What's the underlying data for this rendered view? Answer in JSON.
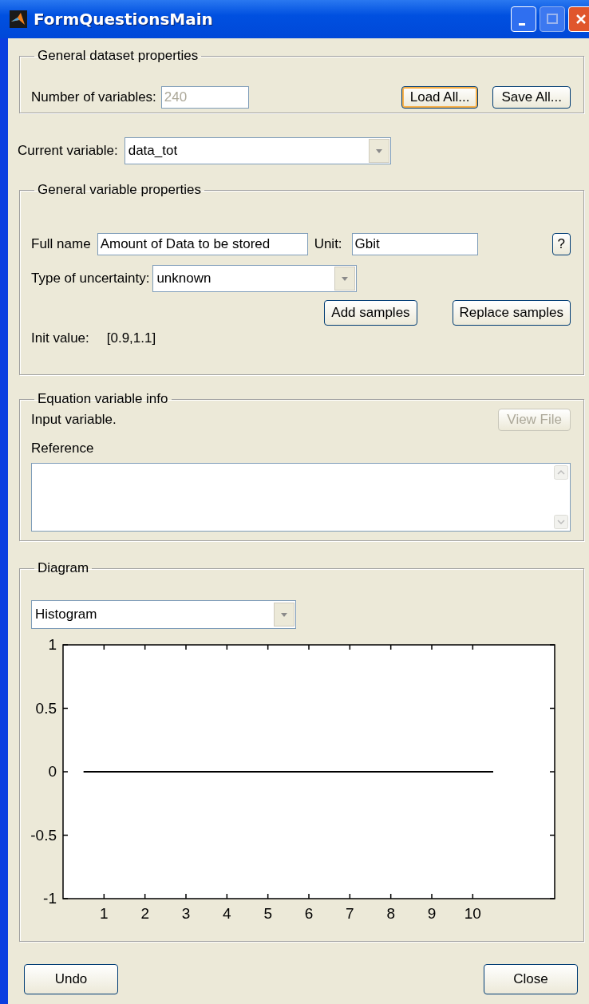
{
  "window": {
    "title": "FormQuestionsMain"
  },
  "dataset_group": {
    "title": "General dataset properties",
    "variables_label": "Number of variables:",
    "variables_field": {
      "value": "240",
      "disabled": true
    },
    "buttons": [
      {
        "label": "Load All...",
        "focused": true
      },
      {
        "label": "Save All...",
        "focused": false
      }
    ]
  },
  "current_variable": {
    "label": "Current variable:",
    "value": "data_tot"
  },
  "variable_group": {
    "title": "General variable properties",
    "full_name_label": "Full name",
    "full_name": "Amount of Data to be stored",
    "unit_label": "Unit:",
    "unit": "Gbit",
    "help_button": "?",
    "uncertainty_label": "Type of uncertainty:",
    "uncertainty": "unknown",
    "buttons": [
      {
        "label": "Add samples"
      },
      {
        "label": "Replace samples"
      }
    ],
    "init_label": "Init value:",
    "init_value": "[0.9,1.1]"
  },
  "equation_group": {
    "title": "Equation variable info",
    "info": "Input variable.",
    "view_file": {
      "label": "View File",
      "disabled": true
    },
    "reference_label": "Reference"
  },
  "diagram_group": {
    "title": "Diagram",
    "plot_type": "Histogram",
    "chart_data": {
      "type": "line",
      "x": [
        0.5,
        10.5
      ],
      "series": [
        {
          "color": "#000000",
          "values": [
            0,
            0
          ]
        }
      ],
      "xlim": [
        0,
        12
      ],
      "ylim": [
        -1,
        1
      ],
      "xticks": [
        1,
        2,
        3,
        4,
        5,
        6,
        7,
        8,
        9,
        10
      ],
      "yticks": [
        -1,
        -0.5,
        0,
        0.5,
        1
      ]
    }
  },
  "buttons": [
    {
      "label": "Undo"
    },
    {
      "label": "Close"
    }
  ]
}
